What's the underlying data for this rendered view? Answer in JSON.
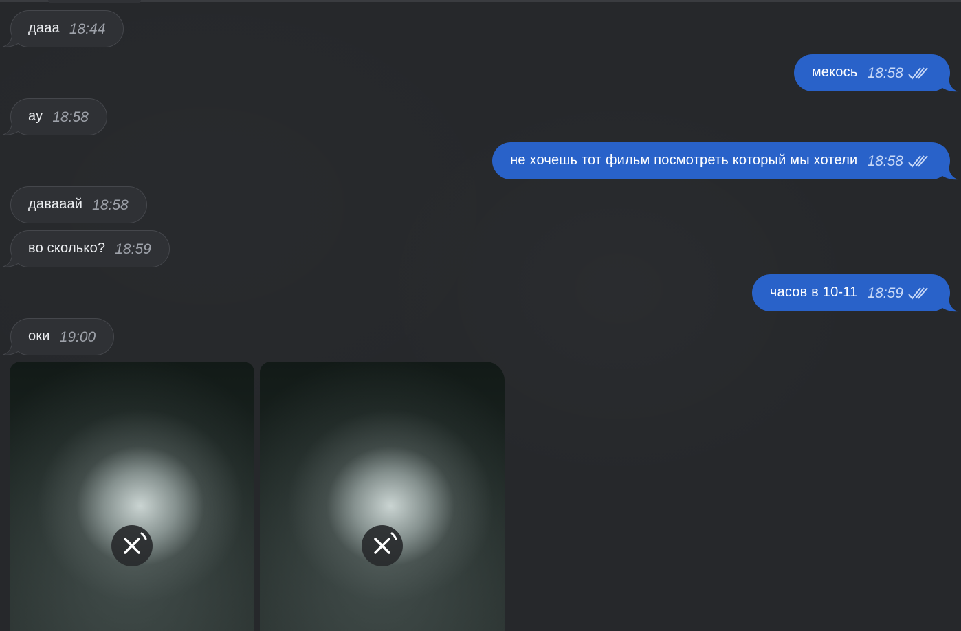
{
  "messages": [
    {
      "id": "m1",
      "direction": "incoming",
      "text": "дааа",
      "time": "18:44"
    },
    {
      "id": "m2",
      "direction": "outgoing",
      "text": "мекось",
      "time": "18:58",
      "status": "read"
    },
    {
      "id": "m3",
      "direction": "incoming",
      "text": "ау",
      "time": "18:58"
    },
    {
      "id": "m4",
      "direction": "outgoing",
      "text": "не хочешь тот фильм посмотреть который мы хотели",
      "time": "18:58",
      "status": "read"
    },
    {
      "id": "m5",
      "direction": "incoming",
      "text": "давааай",
      "time": "18:58"
    },
    {
      "id": "m6",
      "direction": "incoming",
      "text": "во сколько?",
      "time": "18:59"
    },
    {
      "id": "m7",
      "direction": "outgoing",
      "text": "часов в 10-11",
      "time": "18:59",
      "status": "read"
    },
    {
      "id": "m8",
      "direction": "incoming",
      "text": "оки",
      "time": "19:00"
    }
  ],
  "media_album": {
    "direction": "incoming",
    "items": [
      {
        "type": "photo",
        "state": "loading",
        "icon": "cancel-download-icon"
      },
      {
        "type": "photo",
        "state": "loading",
        "icon": "cancel-download-icon"
      }
    ]
  },
  "colors": {
    "background": "#26282b",
    "incoming_bubble": "#2f3135",
    "outgoing_bubble": "#2962c9",
    "incoming_time": "#9ea2aa",
    "outgoing_time": "#c9d9f7"
  }
}
